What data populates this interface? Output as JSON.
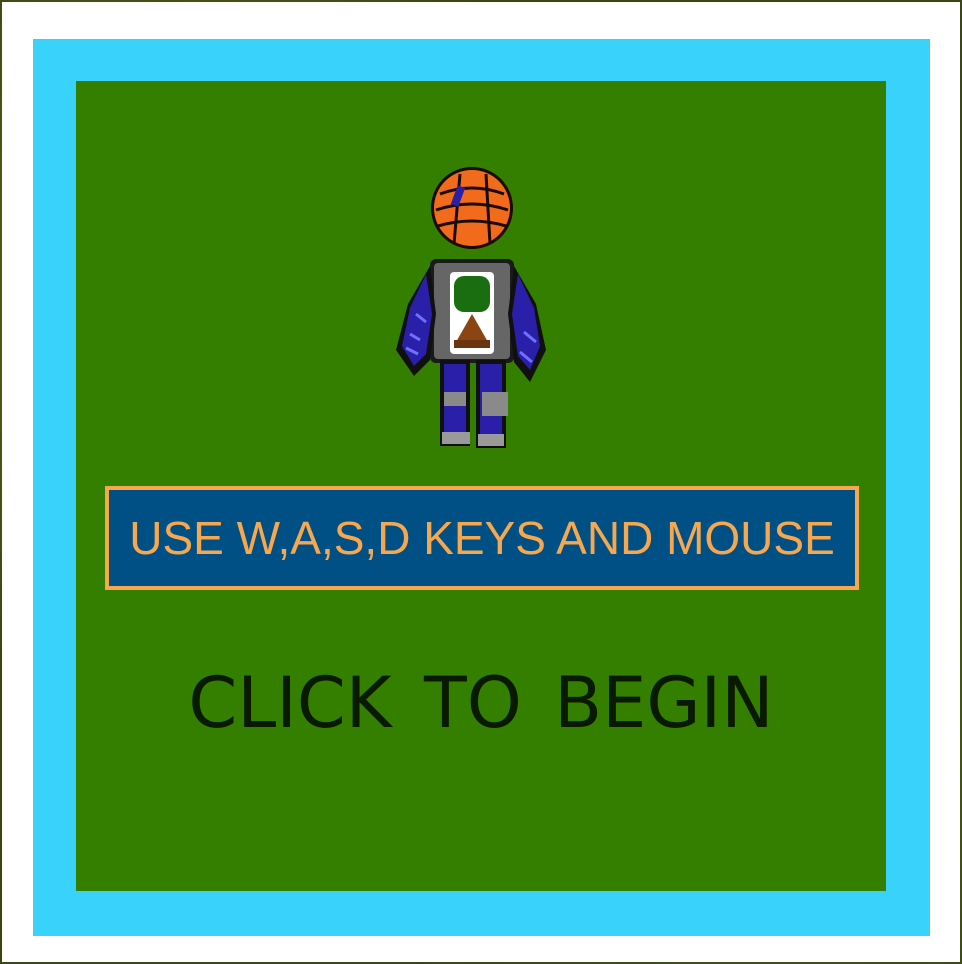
{
  "game": {
    "instruction": "USE W,A,S,D KEYS AND MOUSE",
    "start_prompt": "CLICK TO  BEGIN"
  },
  "character": {
    "icon": "pumpkin-head-robot-character",
    "head_color": "#f26b1d",
    "body_color": "#5a5a5a",
    "accent_color": "#2a1fa8"
  },
  "colors": {
    "outer_frame": "#ffffff",
    "border": "#38d2fa",
    "panel": "#357f00",
    "instruction_bg": "#004f85",
    "instruction_fg": "#f7a84e",
    "prompt_fg": "#0a1a00"
  }
}
